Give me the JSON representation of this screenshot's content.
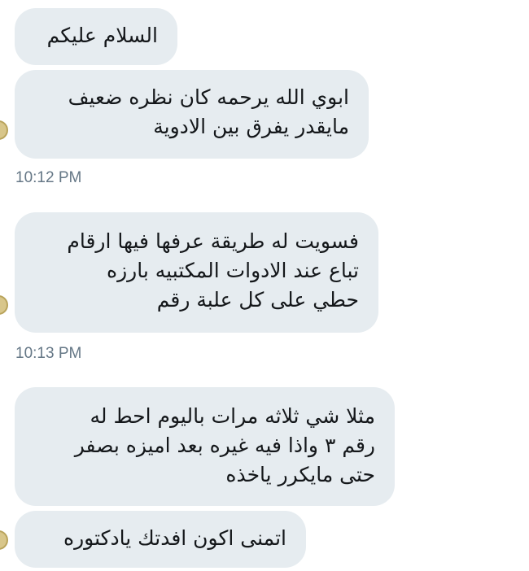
{
  "messages": [
    {
      "lines": [
        "السلام عليكم"
      ]
    },
    {
      "lines": [
        "ابوي الله يرحمه كان نظره ضعيف",
        "مايقدر يفرق بين الادوية"
      ]
    },
    {
      "lines": [
        "فسويت له طريقة عرفها فيها ارقام",
        "تباع عند الادوات المكتبيه بارزه",
        "حطي على كل علبة رقم"
      ]
    },
    {
      "lines": [
        "مثلا شي ثلاثه مرات باليوم احط له",
        "رقم ٣ واذا فيه غيره بعد اميزه بصفر",
        "حتى مايكرر ياخذه"
      ]
    },
    {
      "lines": [
        "اتمنى اكون افدتك يادكتوره"
      ]
    }
  ],
  "timestamps": [
    "10:12 PM",
    "10:13 PM"
  ],
  "colors": {
    "bubble": "#e6ecf0",
    "text": "#14171a",
    "timestamp": "#657786"
  }
}
